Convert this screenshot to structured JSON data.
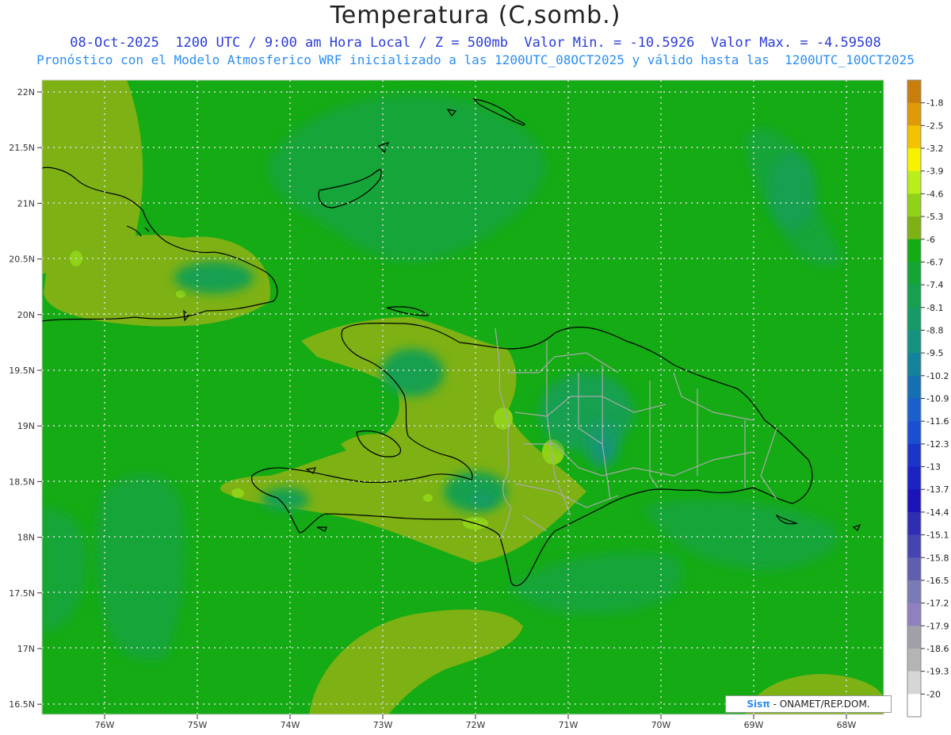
{
  "header": {
    "title": "Temperatura (C,somb.)",
    "line1": "08-Oct-2025  1200 UTC / 9:00 am Hora Local / Z = 500mb  Valor Min. = -10.5926  Valor Max. = -4.59508",
    "line2": "Pronóstico con el Modelo Atmosferico WRF inicializado a las 1200UTC_08OCT2025 y válido hasta las  1200UTC_10OCT2025"
  },
  "axes": {
    "lat_labels": [
      "22N",
      "21.5N",
      "21N",
      "20.5N",
      "20N",
      "19.5N",
      "19N",
      "18.5N",
      "18N",
      "17.5N",
      "17N",
      "16.5N"
    ],
    "lon_labels": [
      "76W",
      "75W",
      "74W",
      "73W",
      "72W",
      "71W",
      "70W",
      "69W",
      "68W"
    ]
  },
  "colorbar": {
    "labels": [
      "-1.8",
      "-2.5",
      "-3.2",
      "-3.9",
      "-4.6",
      "-5.3",
      "-6",
      "-6.7",
      "-7.4",
      "-8.1",
      "-8.8",
      "-9.5",
      "-10.2",
      "-10.9",
      "-11.6",
      "-12.3",
      "-13",
      "-13.7",
      "-14.4",
      "-15.1",
      "-15.8",
      "-16.5",
      "-17.2",
      "-17.9",
      "-18.6",
      "-19.3",
      "-20"
    ],
    "colors": [
      "#c97e0b",
      "#e09a08",
      "#f5c200",
      "#f7f200",
      "#b8ee1a",
      "#8fd217",
      "#7db114",
      "#14ab14",
      "#14a537",
      "#16a04f",
      "#169a68",
      "#169282",
      "#15829b",
      "#1470b3",
      "#1a5fcc",
      "#1a4fd2",
      "#1a35c8",
      "#1a22c2",
      "#1a14b8",
      "#2e2eb4",
      "#4545b2",
      "#5f5fb0",
      "#7a7ab6",
      "#9080bf",
      "#a0a0a8",
      "#b4b4b4",
      "#d6d6d6",
      "#ffffff"
    ]
  },
  "credit": {
    "logo": "Sisπ",
    "text": " - ONAMET/REP.DOM."
  }
}
